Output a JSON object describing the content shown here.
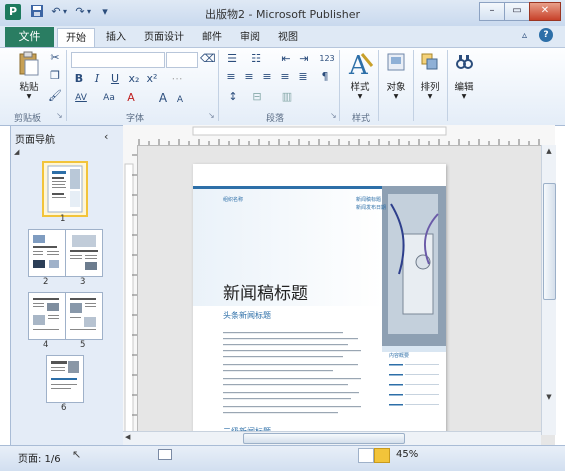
{
  "window": {
    "title": "出版物2 - Microsoft Publisher",
    "app_icon": "P"
  },
  "quick_access": {
    "save_icon": "save-icon",
    "undo_icon": "undo-icon",
    "redo_icon": "redo-icon",
    "customize_icon": "customize-icon"
  },
  "tabs": [
    {
      "label": "文件"
    },
    {
      "label": "开始"
    },
    {
      "label": "插入"
    },
    {
      "label": "页面设计"
    },
    {
      "label": "邮件"
    },
    {
      "label": "审阅"
    },
    {
      "label": "视图"
    }
  ],
  "ribbon": {
    "clipboard": {
      "paste_label": "粘贴",
      "group_label": "剪贴板"
    },
    "font": {
      "group_label": "字体",
      "bold": "B",
      "italic": "I",
      "underline": "U",
      "sub": "x₂",
      "sup": "x²",
      "spacing": "AV",
      "case": "Aa",
      "grow": "A",
      "shrink": "A"
    },
    "paragraph": {
      "group_label": "段落",
      "numbering_label": "123"
    },
    "styles": {
      "group_label": "样式",
      "styles_label": "样式"
    },
    "objects": {
      "object_label": "对象",
      "arrange_label": "排列",
      "edit_label": "编辑"
    }
  },
  "nav": {
    "title": "页面导航",
    "pages": [
      "1",
      "2",
      "3",
      "4",
      "5",
      "6"
    ]
  },
  "document": {
    "header_left": "组织名称",
    "header_right_1": "新闻稿标题",
    "header_right_2": "新闻发布日期",
    "headline": "新闻稿标题",
    "subhead": "头条新闻标题",
    "subhead2": "二级新闻标题",
    "sidebar_title": "内容概要"
  },
  "status": {
    "page": "页面: 1/6",
    "zoom": "45%"
  },
  "colors": {
    "file_tab": "#2a7d62",
    "accent_blue": "#2d6fa8",
    "selection": "#f2c43a"
  }
}
